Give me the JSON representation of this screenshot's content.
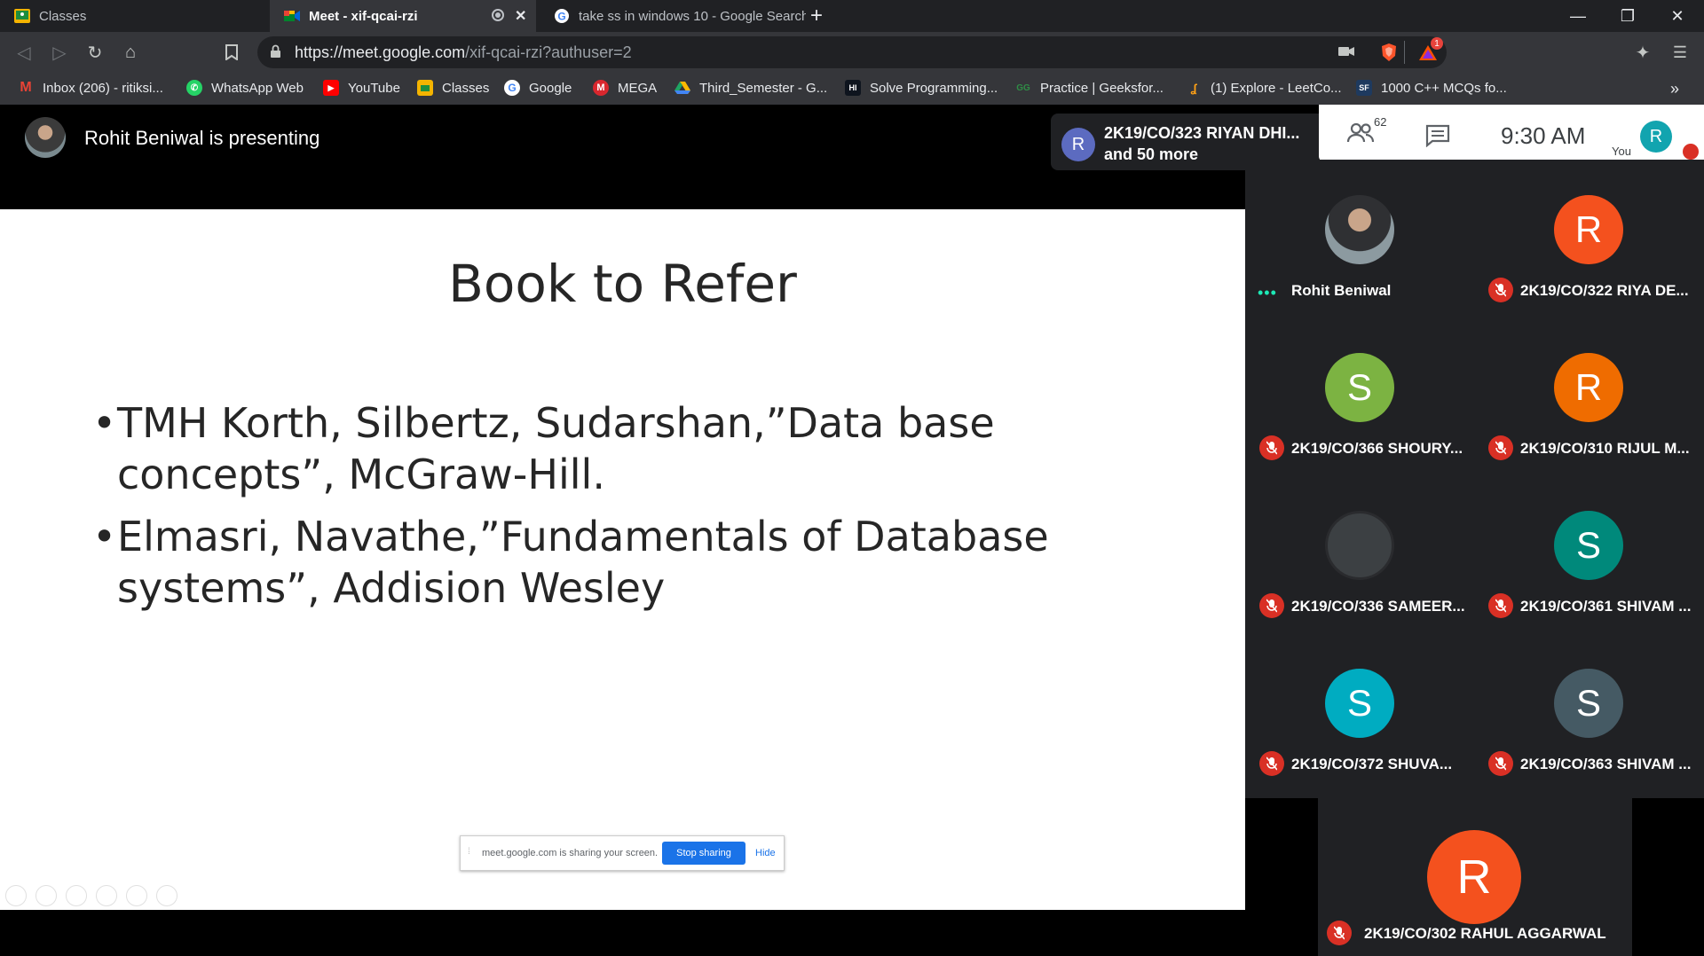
{
  "browser": {
    "tabs": [
      {
        "label": "Classes",
        "icon": "google-classroom-icon"
      },
      {
        "label": "Meet - xif-qcai-rzi",
        "icon": "google-meet-icon",
        "active": true
      },
      {
        "label": "take ss in windows 10 - Google Search",
        "icon": "google-icon"
      }
    ],
    "url_domain": "https://meet.google.com",
    "url_path": "/xif-qcai-rzi?authuser=2",
    "brave_badge": "1",
    "bookmarks": [
      {
        "label": "Inbox (206) - ritiksi...",
        "icon": "M",
        "color": "#ea4335"
      },
      {
        "label": "WhatsApp Web",
        "icon": "✆",
        "color": "#25d366"
      },
      {
        "label": "YouTube",
        "icon": "▶",
        "color": "#ff0000"
      },
      {
        "label": "Classes",
        "icon": "▣",
        "color": "#f4b400"
      },
      {
        "label": "Google",
        "icon": "G",
        "color": "#4285f4"
      },
      {
        "label": "MEGA",
        "icon": "M",
        "color": "#d9272e"
      },
      {
        "label": "Third_Semester - G...",
        "icon": "▲",
        "color": "#1fa463"
      },
      {
        "label": "Solve Programming...",
        "icon": "HI",
        "color": "#1ba94c"
      },
      {
        "label": "Practice | Geeksfor...",
        "icon": "GG",
        "color": "#2f8d46"
      },
      {
        "label": "(1) Explore - LeetCo...",
        "icon": "L",
        "color": "#ffa116"
      },
      {
        "label": "1000 C++ MCQs fo...",
        "icon": "SF",
        "color": "#1e3a5f"
      }
    ]
  },
  "meet": {
    "presenting_text": "Rohit Beniwal is presenting",
    "join_avatar": "R",
    "join_line1": "2K19/CO/323 RIYAN DHI...",
    "join_line2": "and 50 more",
    "participant_count": "62",
    "time": "9:30  AM",
    "you_label": "You",
    "self_initial": "R"
  },
  "slide": {
    "title": "Book to Refer",
    "bullets": [
      "TMH Korth, Silbertz, Sudarshan,”Data base concepts”, McGraw-Hill.",
      "Elmasri, Navathe,”Fundamentals of Database systems”, Addision Wesley"
    ],
    "share_text": "meet.google.com is sharing your screen.",
    "stop_label": "Stop sharing",
    "hide_label": "Hide"
  },
  "participants": [
    {
      "name": "Rohit Beniwal",
      "initial": "",
      "color": "#3b3b3b",
      "muted": false,
      "photo": true
    },
    {
      "name": "2K19/CO/322 RIYA DE...",
      "initial": "R",
      "color": "#f4511e",
      "muted": true
    },
    {
      "name": "2K19/CO/366 SHOURY...",
      "initial": "S",
      "color": "#7cb342",
      "muted": true
    },
    {
      "name": "2K19/CO/310 RIJUL M...",
      "initial": "R",
      "color": "#ef6c00",
      "muted": true
    },
    {
      "name": "2K19/CO/336 SAMEER...",
      "initial": "",
      "color": "#3c4043",
      "muted": true
    },
    {
      "name": "2K19/CO/361 SHIVAM ...",
      "initial": "S",
      "color": "#00897b",
      "muted": true
    },
    {
      "name": "2K19/CO/372 SHUVA...",
      "initial": "S",
      "color": "#00acc1",
      "muted": true
    },
    {
      "name": "2K19/CO/363 SHIVAM ...",
      "initial": "S",
      "color": "#455a64",
      "muted": true
    }
  ],
  "featured": {
    "name": "2K19/CO/302 RAHUL AGGARWAL",
    "initial": "R"
  }
}
